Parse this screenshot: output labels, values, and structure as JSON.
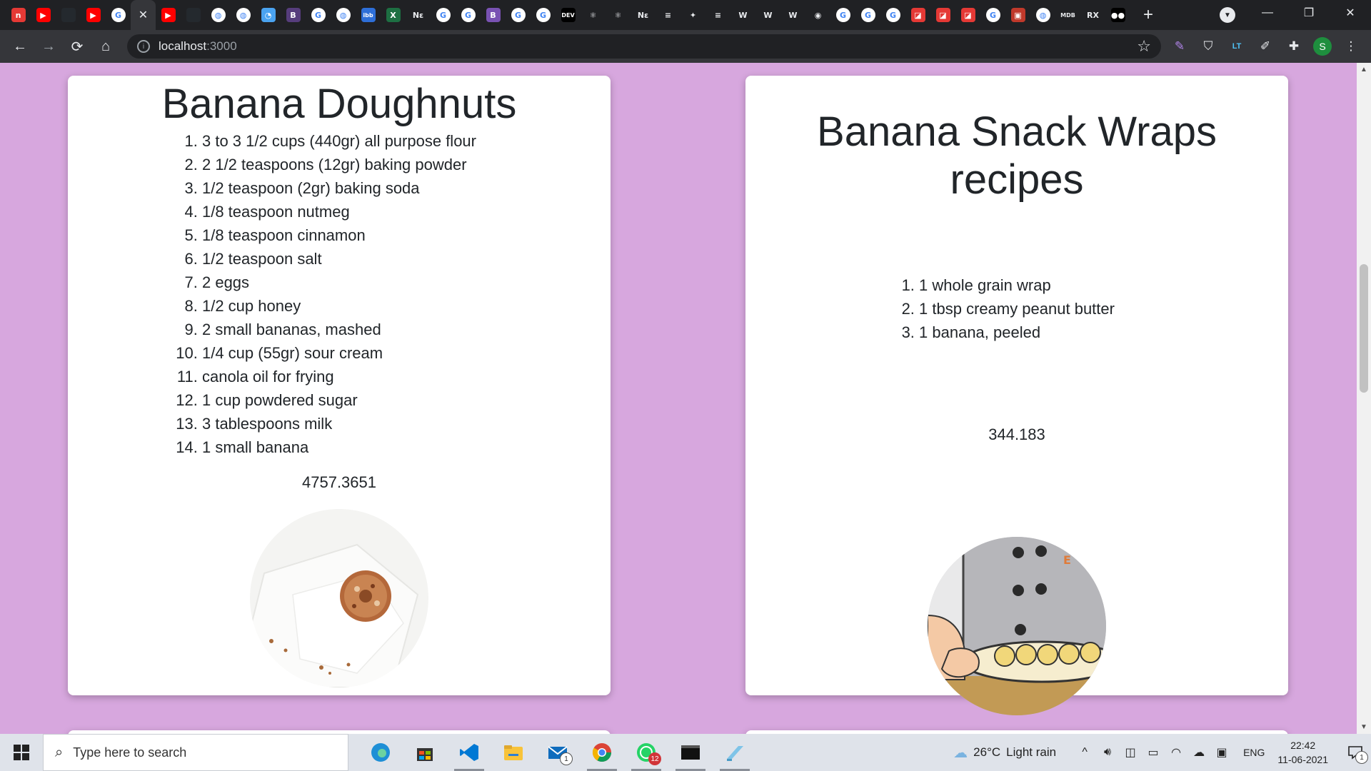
{
  "browser": {
    "url_host": "localhost",
    "url_port": ":3000",
    "profile_initial": "S",
    "tabs": [
      {
        "icon": "n-icon",
        "color": "#e53935",
        "label": "n"
      },
      {
        "icon": "youtube-icon",
        "color": "#ff0000",
        "label": "▶"
      },
      {
        "icon": "github-icon",
        "color": "#24292e",
        "label": ""
      },
      {
        "icon": "youtube-icon",
        "color": "#ff0000",
        "label": "▶"
      },
      {
        "icon": "google-icon",
        "color": "#ffffff",
        "label": "G"
      },
      {
        "icon": "active-tab-close",
        "color": "",
        "label": "✕"
      },
      {
        "icon": "youtube-icon",
        "color": "#ff0000",
        "label": "▶"
      },
      {
        "icon": "github-icon",
        "color": "#24292e",
        "label": ""
      },
      {
        "icon": "globe-icon",
        "color": "#ffffff",
        "label": "◍"
      },
      {
        "icon": "globe-icon",
        "color": "#ffffff",
        "label": "◍"
      },
      {
        "icon": "edge-icon",
        "color": "#4aa3f0",
        "label": "◔"
      },
      {
        "icon": "bootstrap-icon",
        "color": "#563d7c",
        "label": "B"
      },
      {
        "icon": "google-icon",
        "color": "#ffffff",
        "label": "G"
      },
      {
        "icon": "globe-icon",
        "color": "#ffffff",
        "label": "◍"
      },
      {
        "icon": "ibb-icon",
        "color": "#2e6fd8",
        "label": "ibb"
      },
      {
        "icon": "excel-icon",
        "color": "#1d6f42",
        "label": "X"
      },
      {
        "icon": "n-text-icon",
        "color": "",
        "label": "Nε"
      },
      {
        "icon": "google-icon",
        "color": "#ffffff",
        "label": "G"
      },
      {
        "icon": "google-icon",
        "color": "#ffffff",
        "label": "G"
      },
      {
        "icon": "bootstrap-icon",
        "color": "#7952b3",
        "label": "B"
      },
      {
        "icon": "google-icon",
        "color": "#ffffff",
        "label": "G"
      },
      {
        "icon": "google-icon",
        "color": "#ffffff",
        "label": "G"
      },
      {
        "icon": "dev-icon",
        "color": "#000000",
        "label": "DEV"
      },
      {
        "icon": "react-icon",
        "color": "",
        "label": "⚛"
      },
      {
        "icon": "react-icon",
        "color": "",
        "label": "⚛"
      },
      {
        "icon": "n-text-icon",
        "color": "",
        "label": "Nε"
      },
      {
        "icon": "stackoverflow-icon",
        "color": "",
        "label": "≡"
      },
      {
        "icon": "bird-icon",
        "color": "",
        "label": "✦"
      },
      {
        "icon": "stackoverflow-icon",
        "color": "",
        "label": "≡"
      },
      {
        "icon": "w-icon",
        "color": "",
        "label": "W"
      },
      {
        "icon": "w-icon",
        "color": "",
        "label": "W"
      },
      {
        "icon": "w-icon",
        "color": "",
        "label": "W"
      },
      {
        "icon": "owl-icon",
        "color": "",
        "label": "◉"
      },
      {
        "icon": "google-icon",
        "color": "#ffffff",
        "label": "G"
      },
      {
        "icon": "google-icon",
        "color": "#ffffff",
        "label": "G"
      },
      {
        "icon": "google-icon",
        "color": "#ffffff",
        "label": "G"
      },
      {
        "icon": "red-square-icon",
        "color": "#e53935",
        "label": "◪"
      },
      {
        "icon": "red-square-icon",
        "color": "#e53935",
        "label": "◪"
      },
      {
        "icon": "red-square-icon",
        "color": "#e53935",
        "label": "◪"
      },
      {
        "icon": "google-icon",
        "color": "#ffffff",
        "label": "G"
      },
      {
        "icon": "ticket-icon",
        "color": "#c0392b",
        "label": "▣"
      },
      {
        "icon": "globe-icon",
        "color": "#ffffff",
        "label": "◍"
      },
      {
        "icon": "mdb-icon",
        "color": "",
        "label": "MDB"
      },
      {
        "icon": "rx-icon",
        "color": "",
        "label": "RX"
      },
      {
        "icon": "medium-icon",
        "color": "#000000",
        "label": "●●"
      }
    ]
  },
  "recipes": [
    {
      "title": "Banana Doughnuts",
      "ingredients": [
        "3 to 3 1/2 cups (440gr) all purpose flour",
        "2 1/2 teaspoons (12gr) baking powder",
        "1/2 teaspoon (2gr) baking soda",
        "1/8 teaspoon nutmeg",
        "1/8 teaspoon cinnamon",
        "1/2 teaspoon salt",
        "2 eggs",
        "1/2 cup honey",
        "2 small bananas, mashed",
        "1/4 cup (55gr) sour cream",
        "canola oil for frying",
        "1 cup powdered sugar",
        "3 tablespoons milk",
        "1 small banana"
      ],
      "score": "4757.3651"
    },
    {
      "title": "Banana Snack Wraps recipes",
      "ingredients": [
        "1 whole grain wrap",
        "1 tbsp creamy peanut butter",
        "1 banana, peeled"
      ],
      "score": "344.183"
    }
  ],
  "taskbar": {
    "search_placeholder": "Type here to search",
    "mail_badge": "1",
    "whatsapp_badge": "12",
    "weather_temp": "26°C",
    "weather_desc": "Light rain",
    "language": "ENG",
    "time": "22:42",
    "date": "11-06-2021",
    "notification_count": "1"
  }
}
